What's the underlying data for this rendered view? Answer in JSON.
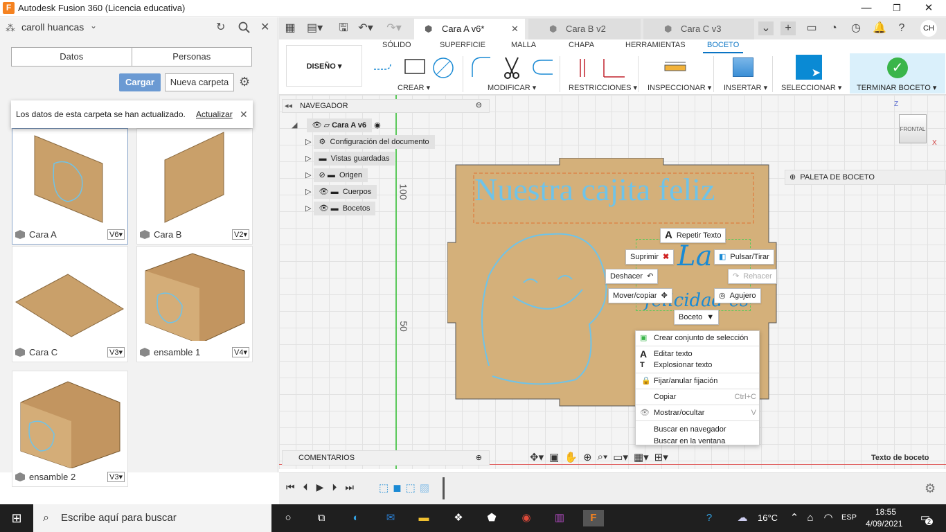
{
  "window": {
    "title": "Autodesk Fusion 360 (Licencia educativa)",
    "logo": "F"
  },
  "left_panel": {
    "user": "caroll huancas",
    "seg_tabs": [
      "Datos",
      "Personas"
    ],
    "upload_label": "Cargar",
    "new_folder_label": "Nueva carpeta",
    "toast": {
      "message": "Los datos de esta carpeta se han actualizado.",
      "action": "Actualizar"
    },
    "files": [
      {
        "name": "Cara A",
        "version": "V6"
      },
      {
        "name": "Cara B",
        "version": "V2"
      },
      {
        "name": "Cara C",
        "version": "V3"
      },
      {
        "name": "ensamble 1",
        "version": "V4"
      },
      {
        "name": "ensamble 2",
        "version": "V3"
      }
    ]
  },
  "tabs": [
    {
      "label": "Cara A v6*",
      "active": true
    },
    {
      "label": "Cara B v2"
    },
    {
      "label": "Cara C v3"
    }
  ],
  "user_initials": "CH",
  "toolbar": {
    "workspace": "DISEÑO",
    "tabs": [
      "SÓLIDO",
      "SUPERFICIE",
      "MALLA",
      "CHAPA",
      "HERRAMIENTAS",
      "BOCETO"
    ],
    "groups": [
      "CREAR",
      "MODIFICAR",
      "RESTRICCIONES",
      "INSPECCIONAR",
      "INSERTAR",
      "SELECCIONAR",
      "TERMINAR BOCETO"
    ]
  },
  "navigator": {
    "title": "NAVEGADOR",
    "root": "Cara A v6",
    "items": [
      "Configuración del documento",
      "Vistas guardadas",
      "Origen",
      "Cuerpos",
      "Bocetos"
    ]
  },
  "comments_label": "COMENTARIOS",
  "palette_label": "PALETA DE BOCETO",
  "viewcube": {
    "face": "FRONTAL",
    "z": "Z",
    "x": "X"
  },
  "sketch": {
    "headline": "Nuestra cajita feliz",
    "script1": "La",
    "script2": "felicidad es",
    "ruler_100": "100",
    "ruler_50": "50"
  },
  "marking_menu": {
    "repeat": "Repetir Texto",
    "delete": "Suprimir",
    "pushpull": "Pulsar/Tirar",
    "undo": "Deshacer",
    "redo": "Rehacer",
    "move": "Mover/copiar",
    "hole": "Agujero",
    "sketch": "Boceto"
  },
  "context_menu": [
    {
      "label": "Crear conjunto de selección"
    },
    {
      "label": "Editar texto"
    },
    {
      "label": "Explosionar texto"
    },
    {
      "label": "Fijar/anular fijación"
    },
    {
      "label": "Copiar",
      "shortcut": "Ctrl+C"
    },
    {
      "label": "Mostrar/ocultar",
      "shortcut": "V"
    },
    {
      "label": "Buscar en navegador"
    },
    {
      "label": "Buscar en la ventana"
    }
  ],
  "status_text": "Texto de boceto",
  "taskbar": {
    "search_placeholder": "Escribe aquí para buscar",
    "temp": "16°C",
    "lang": "ESP",
    "time": "18:55",
    "date": "4/09/2021",
    "notif": "2"
  }
}
